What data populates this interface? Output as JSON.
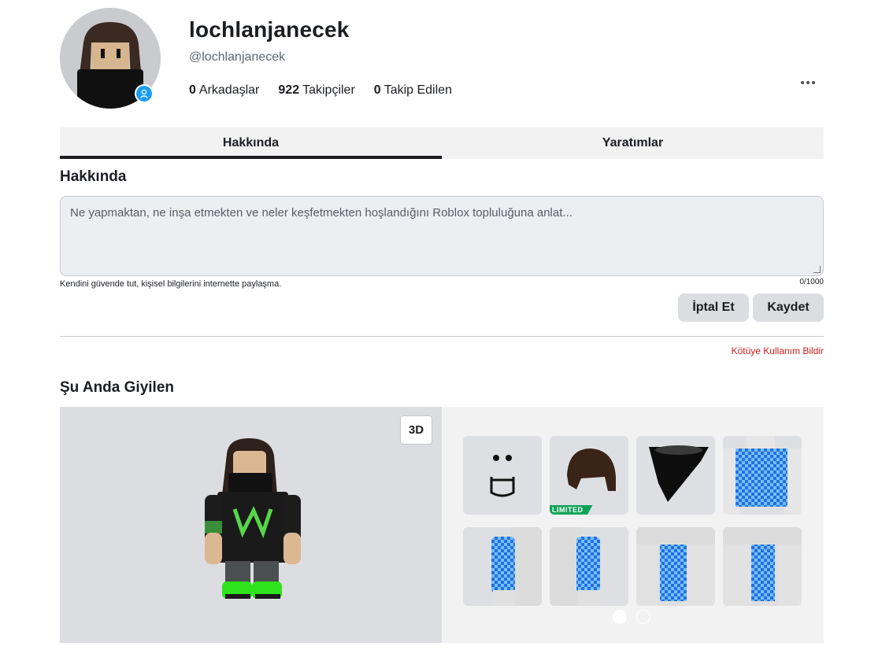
{
  "profile": {
    "display_name": "lochlanjanecek",
    "username": "@lochlanjanecek",
    "stats": [
      {
        "count": "0",
        "label": "Arkadaşlar"
      },
      {
        "count": "922",
        "label": "Takipçiler"
      },
      {
        "count": "0",
        "label": "Takip Edilen"
      }
    ],
    "online_icon": "person-icon"
  },
  "tabs": [
    {
      "label": "Hakkında",
      "active": true
    },
    {
      "label": "Yaratımlar",
      "active": false
    }
  ],
  "about": {
    "heading": "Hakkında",
    "placeholder": "Ne yapmaktan, ne inşa etmekten ve neler keşfetmekten hoşlandığını Roblox topluluğuna anlat...",
    "hint": "Kendini güvende tut, kişisel bilgilerini internette paylaşma.",
    "counter": "0/1000",
    "cancel_label": "İptal Et",
    "save_label": "Kaydet",
    "report_label": "Kötüye Kullanım Bildir"
  },
  "wearing": {
    "heading": "Şu Anda Giyilen",
    "toggle_3d_label": "3D",
    "limited_label": "LIMITED",
    "items": [
      {
        "name": "face"
      },
      {
        "name": "hair",
        "limited": true
      },
      {
        "name": "bandana"
      },
      {
        "name": "shirt-front"
      },
      {
        "name": "left-sleeve"
      },
      {
        "name": "right-sleeve"
      },
      {
        "name": "left-leg"
      },
      {
        "name": "right-leg"
      }
    ],
    "page_count": 2,
    "current_page": 1
  },
  "colors": {
    "accent_online": "#1a9cf5",
    "report": "#d21c1c",
    "limited_badge": "#11a35a"
  }
}
